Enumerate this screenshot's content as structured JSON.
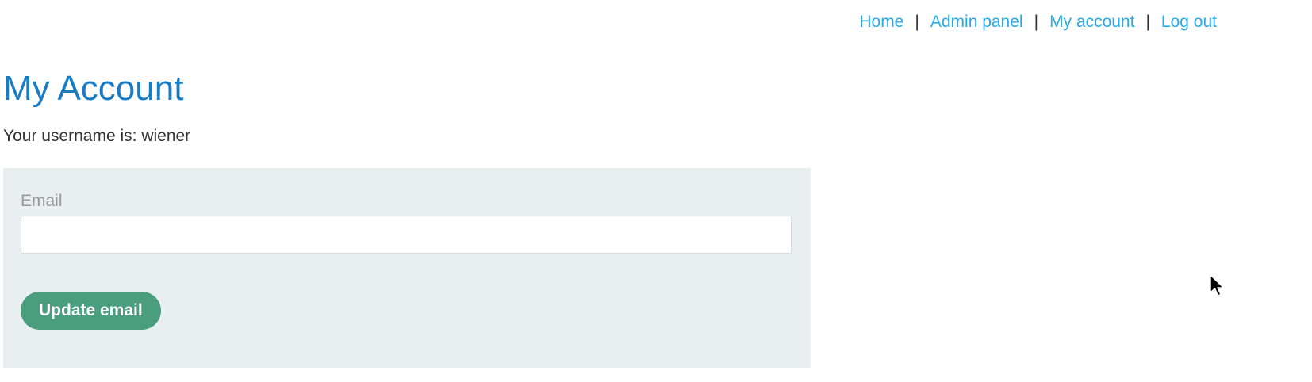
{
  "nav": {
    "links": [
      "Home",
      "Admin panel",
      "My account",
      "Log out"
    ],
    "separator": "|"
  },
  "main": {
    "title": "My Account",
    "username_line": "Your username is: wiener"
  },
  "form": {
    "email_label": "Email",
    "email_value": "",
    "button_label": "Update email"
  },
  "colors": {
    "link": "#29abe2",
    "title": "#1a7bc5",
    "button": "#4a9e7d",
    "form_bg": "#e9eef1"
  },
  "icons": {
    "cursor": "mouse-pointer-icon"
  }
}
